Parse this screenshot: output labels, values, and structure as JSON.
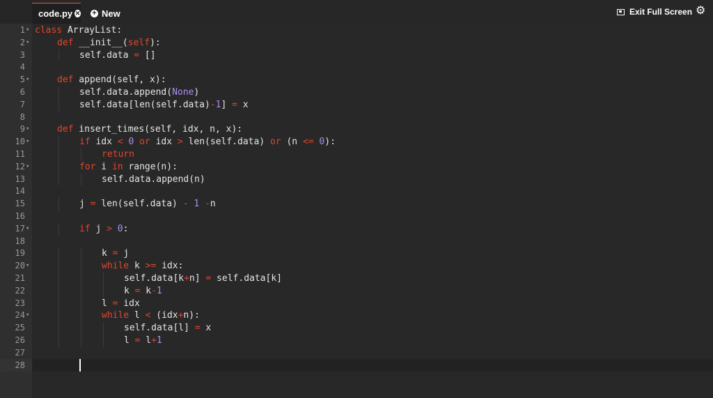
{
  "tab": {
    "label": "code.py"
  },
  "toolbar": {
    "new_label": "New",
    "exit_fullscreen_label": "Exit Full Screen"
  },
  "icons": {
    "close": "close-icon",
    "new": "plus-icon",
    "fullscreen": "fullscreen-icon",
    "settings": "gear-icon"
  },
  "colors": {
    "keyword": "#e2452e",
    "constant": "#a88ff0",
    "text": "#e6e6e6",
    "tab_accent": "#d8692e"
  },
  "editor": {
    "lines": [
      {
        "n": "1",
        "fold": true,
        "indent": 0,
        "tokens": [
          [
            "kw",
            "class"
          ],
          [
            "t",
            " ArrayList:"
          ]
        ]
      },
      {
        "n": "2",
        "fold": true,
        "indent": 1,
        "tokens": [
          [
            "kw",
            "def"
          ],
          [
            "t",
            " __init__("
          ],
          [
            "kw",
            "self"
          ],
          [
            "t",
            "):"
          ]
        ]
      },
      {
        "n": "3",
        "fold": false,
        "indent": 2,
        "tokens": [
          [
            "t",
            "self.data "
          ],
          [
            "op",
            "="
          ],
          [
            "t",
            " []"
          ]
        ]
      },
      {
        "n": "4",
        "fold": false,
        "indent": 0,
        "tokens": []
      },
      {
        "n": "5",
        "fold": true,
        "indent": 1,
        "tokens": [
          [
            "kw",
            "def"
          ],
          [
            "t",
            " append(self, x):"
          ]
        ]
      },
      {
        "n": "6",
        "fold": false,
        "indent": 2,
        "tokens": [
          [
            "t",
            "self.data.append("
          ],
          [
            "cn",
            "None"
          ],
          [
            "t",
            ")"
          ]
        ]
      },
      {
        "n": "7",
        "fold": false,
        "indent": 2,
        "tokens": [
          [
            "t",
            "self.data[len(self.data)"
          ],
          [
            "op",
            "-"
          ],
          [
            "cn",
            "1"
          ],
          [
            "t",
            "] "
          ],
          [
            "op",
            "="
          ],
          [
            "t",
            " x"
          ]
        ]
      },
      {
        "n": "8",
        "fold": false,
        "indent": 0,
        "tokens": []
      },
      {
        "n": "9",
        "fold": true,
        "indent": 1,
        "tokens": [
          [
            "kw",
            "def"
          ],
          [
            "t",
            " insert_times(self, idx, n, x):"
          ]
        ]
      },
      {
        "n": "10",
        "fold": true,
        "indent": 2,
        "tokens": [
          [
            "kw",
            "if"
          ],
          [
            "t",
            " idx "
          ],
          [
            "op",
            "<"
          ],
          [
            "t",
            " "
          ],
          [
            "cn",
            "0"
          ],
          [
            "t",
            " "
          ],
          [
            "kw",
            "or"
          ],
          [
            "t",
            " idx "
          ],
          [
            "op",
            ">"
          ],
          [
            "t",
            " len(self.data) "
          ],
          [
            "kw",
            "or"
          ],
          [
            "t",
            " (n "
          ],
          [
            "op",
            "<="
          ],
          [
            "t",
            " "
          ],
          [
            "cn",
            "0"
          ],
          [
            "t",
            "):"
          ]
        ]
      },
      {
        "n": "11",
        "fold": false,
        "indent": 3,
        "tokens": [
          [
            "kw",
            "return"
          ]
        ]
      },
      {
        "n": "12",
        "fold": true,
        "indent": 2,
        "tokens": [
          [
            "kw",
            "for"
          ],
          [
            "t",
            " i "
          ],
          [
            "kw",
            "in"
          ],
          [
            "t",
            " range(n):"
          ]
        ]
      },
      {
        "n": "13",
        "fold": false,
        "indent": 3,
        "tokens": [
          [
            "t",
            "self.data.append(n)"
          ]
        ]
      },
      {
        "n": "14",
        "fold": false,
        "indent": 0,
        "tokens": []
      },
      {
        "n": "15",
        "fold": false,
        "indent": 2,
        "tokens": [
          [
            "t",
            "j "
          ],
          [
            "op",
            "="
          ],
          [
            "t",
            " len(self.data) "
          ],
          [
            "op",
            "-"
          ],
          [
            "t",
            " "
          ],
          [
            "cn",
            "1"
          ],
          [
            "t",
            " "
          ],
          [
            "op",
            "-"
          ],
          [
            "t",
            "n"
          ]
        ]
      },
      {
        "n": "16",
        "fold": false,
        "indent": 0,
        "tokens": []
      },
      {
        "n": "17",
        "fold": true,
        "indent": 2,
        "tokens": [
          [
            "kw",
            "if"
          ],
          [
            "t",
            " j "
          ],
          [
            "op",
            ">"
          ],
          [
            "t",
            " "
          ],
          [
            "cn",
            "0"
          ],
          [
            "t",
            ":"
          ]
        ]
      },
      {
        "n": "18",
        "fold": false,
        "indent": 0,
        "tokens": []
      },
      {
        "n": "19",
        "fold": false,
        "indent": 3,
        "tokens": [
          [
            "t",
            "k "
          ],
          [
            "op",
            "="
          ],
          [
            "t",
            " j"
          ]
        ]
      },
      {
        "n": "20",
        "fold": true,
        "indent": 3,
        "tokens": [
          [
            "kw",
            "while"
          ],
          [
            "t",
            " k "
          ],
          [
            "op",
            ">="
          ],
          [
            "t",
            " idx:"
          ]
        ]
      },
      {
        "n": "21",
        "fold": false,
        "indent": 4,
        "tokens": [
          [
            "t",
            "self.data[k"
          ],
          [
            "op",
            "+"
          ],
          [
            "t",
            "n] "
          ],
          [
            "op",
            "="
          ],
          [
            "t",
            " self.data[k]"
          ]
        ]
      },
      {
        "n": "22",
        "fold": false,
        "indent": 4,
        "tokens": [
          [
            "t",
            "k "
          ],
          [
            "op",
            "="
          ],
          [
            "t",
            " k"
          ],
          [
            "op",
            "-"
          ],
          [
            "cn",
            "1"
          ]
        ]
      },
      {
        "n": "23",
        "fold": false,
        "indent": 3,
        "tokens": [
          [
            "t",
            "l "
          ],
          [
            "op",
            "="
          ],
          [
            "t",
            " idx"
          ]
        ]
      },
      {
        "n": "24",
        "fold": true,
        "indent": 3,
        "tokens": [
          [
            "kw",
            "while"
          ],
          [
            "t",
            " l "
          ],
          [
            "op",
            "<"
          ],
          [
            "t",
            " (idx"
          ],
          [
            "op",
            "+"
          ],
          [
            "t",
            "n):"
          ]
        ]
      },
      {
        "n": "25",
        "fold": false,
        "indent": 4,
        "tokens": [
          [
            "t",
            "self.data[l] "
          ],
          [
            "op",
            "="
          ],
          [
            "t",
            " x"
          ]
        ]
      },
      {
        "n": "26",
        "fold": false,
        "indent": 4,
        "tokens": [
          [
            "t",
            "l "
          ],
          [
            "op",
            "="
          ],
          [
            "t",
            " l"
          ],
          [
            "op",
            "+"
          ],
          [
            "cn",
            "1"
          ]
        ]
      },
      {
        "n": "27",
        "fold": false,
        "indent": 0,
        "tokens": []
      },
      {
        "n": "28",
        "fold": false,
        "indent": 0,
        "tokens": []
      }
    ]
  }
}
